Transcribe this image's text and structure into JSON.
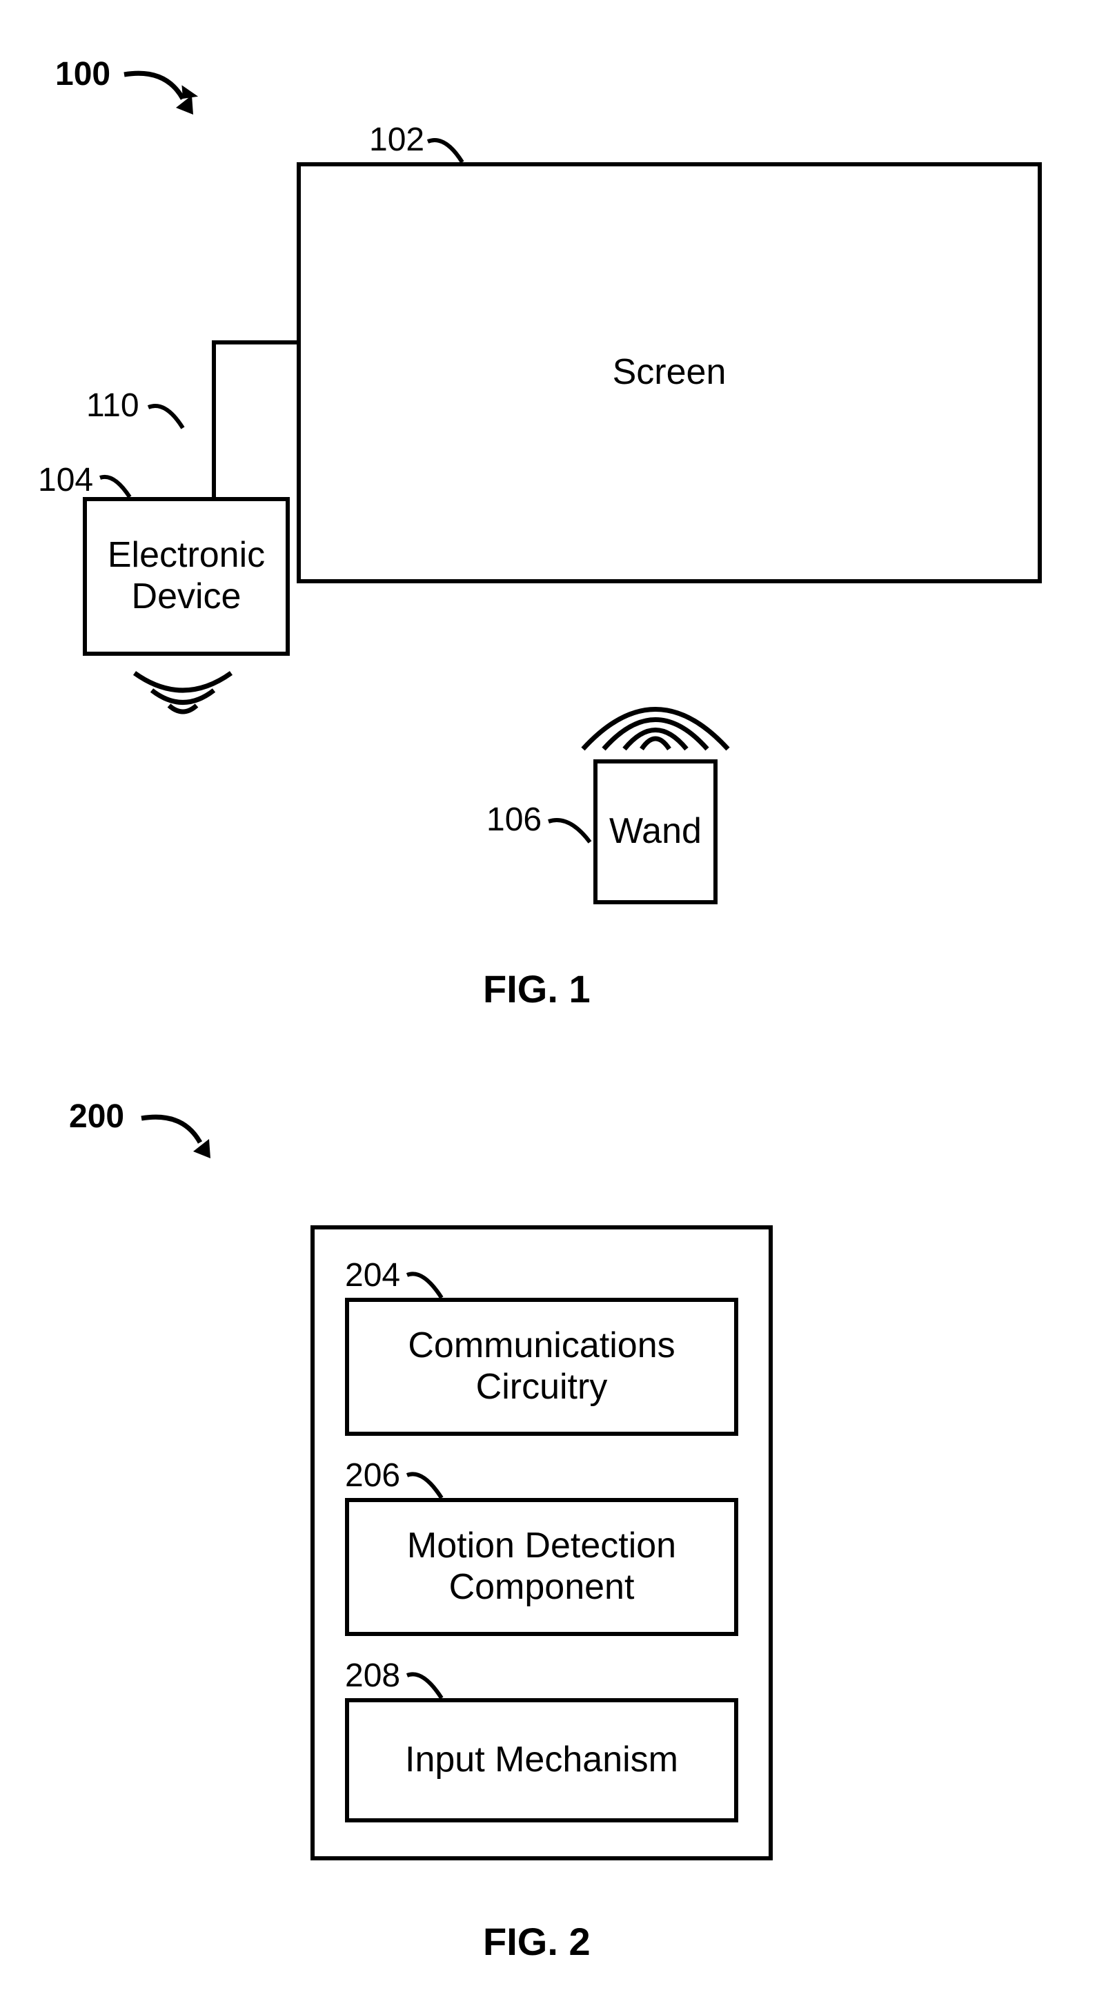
{
  "fig1": {
    "ref_100": "100",
    "ref_102": "102",
    "ref_104": "104",
    "ref_106": "106",
    "ref_110": "110",
    "screen": "Screen",
    "device": "Electronic\nDevice",
    "wand": "Wand",
    "caption": "FIG. 1"
  },
  "fig2": {
    "ref_200": "200",
    "ref_204": "204",
    "ref_206": "206",
    "ref_208": "208",
    "comm": "Communications\nCircuitry",
    "motion": "Motion Detection\nComponent",
    "input": "Input Mechanism",
    "caption": "FIG. 2"
  }
}
